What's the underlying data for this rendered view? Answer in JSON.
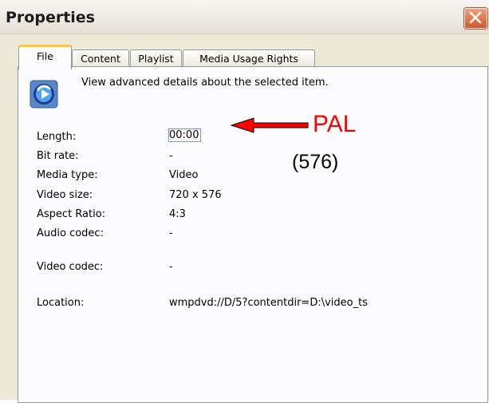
{
  "window": {
    "title": "Properties"
  },
  "tabs": [
    {
      "label": "File",
      "active": true
    },
    {
      "label": "Content",
      "active": false
    },
    {
      "label": "Playlist",
      "active": false
    },
    {
      "label": "Media Usage Rights",
      "active": false
    }
  ],
  "panel": {
    "icon": "media-player-icon",
    "description": "View advanced details about the selected item."
  },
  "details": {
    "length": {
      "label": "Length:",
      "value": "00:00"
    },
    "bit_rate": {
      "label": "Bit rate:",
      "value": "-"
    },
    "media_type": {
      "label": "Media type:",
      "value": "Video"
    },
    "video_size": {
      "label": "Video size:",
      "value": "720 x 576"
    },
    "aspect_ratio": {
      "label": "Aspect Ratio:",
      "value": "4:3"
    },
    "audio_codec": {
      "label": "Audio codec:",
      "value": "-"
    },
    "video_codec": {
      "label": "Video codec:",
      "value": "-"
    },
    "location": {
      "label": "Location:",
      "value": "wmpdvd://D/5?contentdir=D:\\video_ts"
    }
  },
  "annotation": {
    "text": "PAL",
    "subtext": "(576)",
    "color": "#ff0000",
    "arrow_icon": "left-arrow-icon"
  },
  "colors": {
    "tab_highlight": "#ffc83c",
    "close_button": "#d8542c"
  }
}
